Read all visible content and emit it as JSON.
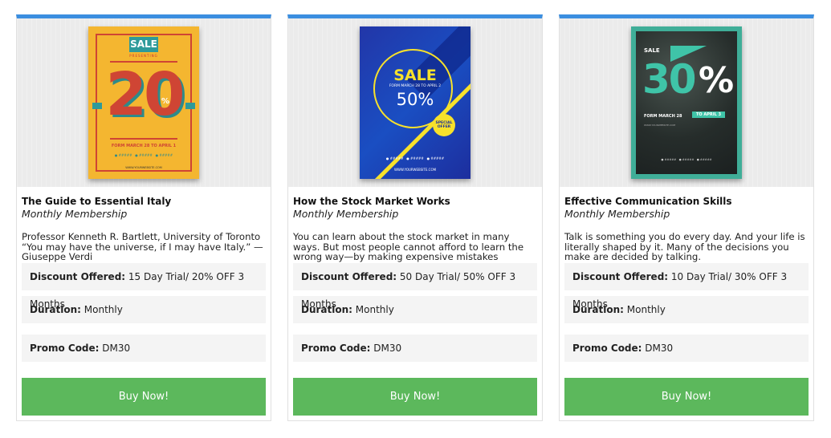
{
  "cards": [
    {
      "title": "The Guide to Essential Italy",
      "subtitle": "Monthly Membership",
      "description": "Professor Kenneth R. Bartlett, University of Toronto “You may have the universe, if I may have Italy.” — Giuseppe Verdi",
      "discount_label": "Discount Offered:",
      "discount_value": "15 Day Trial/ 20% OFF 3 Months",
      "duration_label": "Duration:",
      "duration_value": "Monthly",
      "promo_label": "Promo Code:",
      "promo_value": "DM30",
      "button_label": "Buy Now!",
      "poster": {
        "sale": "SALE",
        "presenting": "PRESENTING",
        "number": "20",
        "percent": "%",
        "date": "FORM MARCH 28 TO APRIL 1",
        "contacts": "● #####   ● #####   ● #####",
        "website": "WWW.YOURWEBSITE.COM"
      }
    },
    {
      "title": "How the Stock Market Works",
      "subtitle": "Monthly Membership",
      "description": "You can learn about the stock market in many ways. But most people cannot afford to learn the wrong way—by making expensive mistakes",
      "discount_label": "Discount Offered:",
      "discount_value": "50 Day Trial/ 50% OFF 3 Months",
      "duration_label": "Duration:",
      "duration_value": "Monthly",
      "promo_label": "Promo Code:",
      "promo_value": "DM30",
      "button_label": "Buy Now!",
      "poster": {
        "sale": "SALE",
        "date": "FORM MARCH 28 TO APRIL 2",
        "percent_text": "50%",
        "badge": "SPECIAL OFFER",
        "contacts": "● #####   ● #####   ● #####",
        "website": "WWW.YOURWEBSITE.COM"
      }
    },
    {
      "title": "Effective Communication Skills",
      "subtitle": "Monthly Membership",
      "description": "Talk is something you do every day. And your life is literally shaped by it. Many of the decisions you make are decided by talking.",
      "discount_label": "Discount Offered:",
      "discount_value": "10 Day Trial/ 30% OFF 3 Months",
      "duration_label": "Duration:",
      "duration_value": "Monthly",
      "promo_label": "Promo Code:",
      "promo_value": "DM30",
      "button_label": "Buy Now!",
      "poster": {
        "sale": "SALE",
        "number": "30",
        "percent": "%",
        "date": "FORM MARCH 28",
        "to": "TO APRIL 3",
        "website": "WWW.YOURWEBSITE.COM",
        "contacts": "● #####   ● #####   ● #####"
      }
    }
  ],
  "colors": {
    "accent_top": "#3b8ee0",
    "buy_button": "#5cb85c",
    "row_background": "#f4f4f4"
  }
}
